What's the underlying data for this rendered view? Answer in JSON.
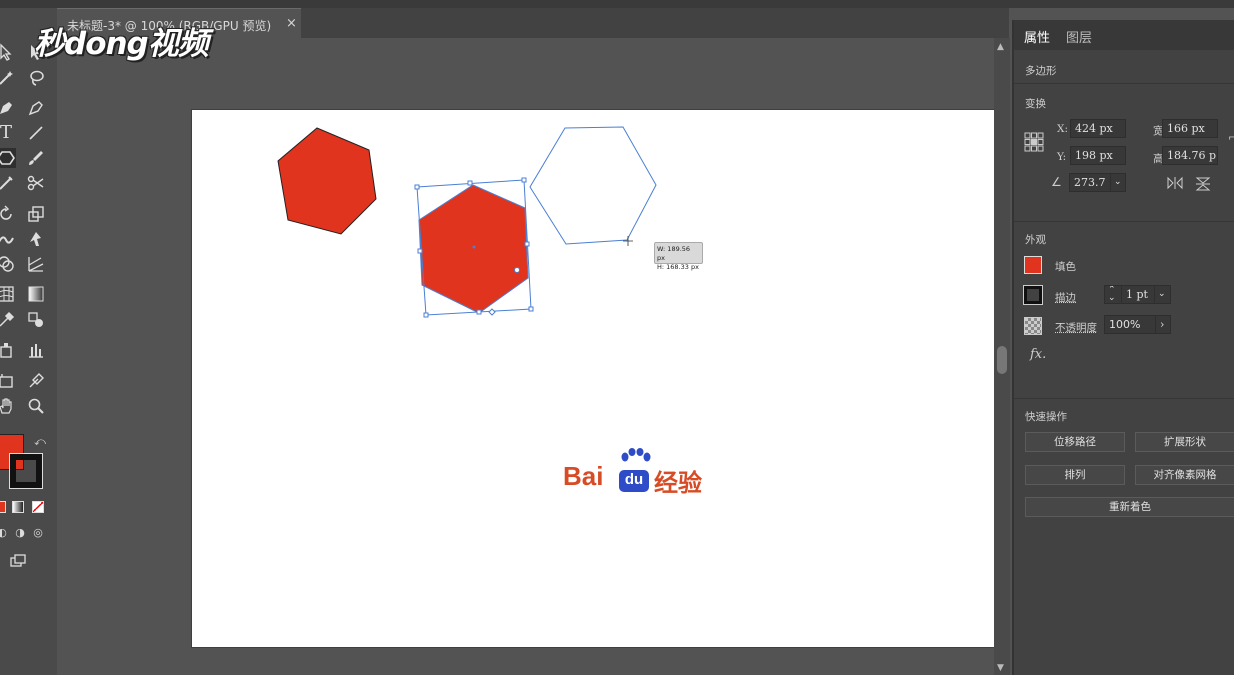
{
  "document_tab": {
    "title": "未标题-3* @ 100% (RGB/GPU 预览)",
    "close": "×"
  },
  "watermark": {
    "text": "秒dong视频"
  },
  "canvas": {
    "tooltip": {
      "w": "W: 189.56 px",
      "h": "H: 168.33 px"
    },
    "logo": {
      "bai": "Bai",
      "du": "du",
      "suffix": "经验"
    }
  },
  "panel": {
    "tabs": [
      "属性",
      "图层"
    ],
    "object_type": "多边形",
    "transform": {
      "title": "变换",
      "x_label": "X:",
      "x_value": "424 px",
      "y_label": "Y:",
      "y_value": "198 px",
      "w_label": "宽:",
      "w_value": "166 px",
      "h_label": "高:",
      "h_value": "184.76 p",
      "angle_value": "273.7"
    },
    "appearance": {
      "title": "外观",
      "fill_label": "填色",
      "stroke_label": "描边",
      "stroke_value": "1 pt",
      "opacity_label": "不透明度",
      "opacity_value": "100%",
      "fx_label": "fx."
    },
    "quick_actions": {
      "title": "快速操作",
      "buttons": [
        "位移路径",
        "扩展形状",
        "排列",
        "对齐像素网格",
        "重新着色"
      ]
    }
  },
  "colors": {
    "fill": "#e0341f",
    "selection": "#4a7fd4",
    "panel": "#424242",
    "canvas_bg": "#535353"
  }
}
